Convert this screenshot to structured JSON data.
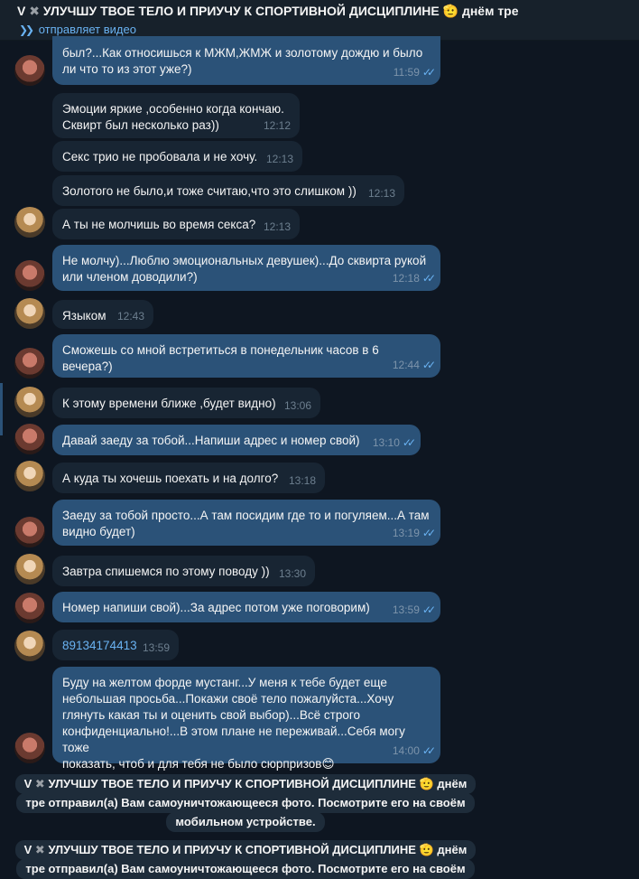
{
  "header": {
    "name_prefix": "V",
    "name_rest": "УЛУЧШУ ТВОЕ ТЕЛО И ПРИУЧУ К СПОРТИВНОЙ ДИСЦИПЛИНЕ",
    "name_suffix": "днём тре",
    "status": "отправляет видео",
    "icons": {
      "x": "✖",
      "salute": "🫡"
    }
  },
  "messages": [
    {
      "dir": "out",
      "text": "был?...Как относишься к МЖМ,ЖМЖ и золотому дождю и было\nли что то из этот уже?)",
      "time": "11:59",
      "read": "✓✓"
    },
    {
      "dir": "in",
      "text": "Эмоции яркие ,особенно когда кончаю.\nСквирт был несколько раз))",
      "time": "12:12"
    },
    {
      "dir": "in",
      "text": "Секс трио не пробовала и не хочу.",
      "time": "12:13"
    },
    {
      "dir": "in",
      "text": "Золотого не было,и тоже считаю,что это слишком ))",
      "time": "12:13"
    },
    {
      "dir": "in",
      "text": "А ты не молчишь во время секса?",
      "time": "12:13"
    },
    {
      "dir": "out",
      "text": "Не молчу)...Люблю эмоциональных девушек)...До сквирта рукой\nили членом доводили?)",
      "time": "12:18",
      "read": "✓✓"
    },
    {
      "dir": "in",
      "text": "Языком",
      "time": "12:43"
    },
    {
      "dir": "out",
      "text": "Сможешь со мной встретиться в понедельник часов в 6 вечера?)",
      "time": "12:44",
      "read": "✓✓"
    },
    {
      "dir": "in",
      "text": "К этому времени ближе ,будет видно)",
      "time": "13:06"
    },
    {
      "dir": "out",
      "text": "Давай заеду за тобой...Напиши адрес и номер свой)",
      "time": "13:10",
      "read": "✓✓"
    },
    {
      "dir": "in",
      "text": "А куда ты хочешь поехать и на долго?",
      "time": "13:18"
    },
    {
      "dir": "out",
      "text": "Заеду за тобой просто...А там посидим где то и погуляем...А там\nвидно будет)",
      "time": "13:19",
      "read": "✓✓"
    },
    {
      "dir": "in",
      "text": "Завтра спишемся по этому поводу ))",
      "time": "13:30"
    },
    {
      "dir": "out",
      "text": "Номер напиши свой)...За адрес потом уже поговорим)",
      "time": "13:59",
      "read": "✓✓"
    },
    {
      "dir": "in",
      "text": "89134174413",
      "time": "13:59"
    },
    {
      "dir": "out",
      "text": "Буду на желтом форде мустанг...У меня к тебе будет еще\nнебольшая просьба...Покажи своё тело пожалуйста...Хочу\nглянуть какая ты и оценить свой выбор)...Всё строго\nконфиденциально!...В этом плане не переживай...Себя могу тоже\nпоказать, чтоб и для тебя не было сюрпризов",
      "emoji": "😊",
      "time": "14:00",
      "read": "✓✓"
    }
  ],
  "system_notices": [
    {
      "line1_prefix": "V",
      "line1_name": "УЛУЧШУ ТВОЕ ТЕЛО И ПРИУЧУ К СПОРТИВНОЙ ДИСЦИПЛИНЕ",
      "line1_suffix": "днём",
      "line2": "тре отправил(а) Вам самоуничтожающееся фото. Посмотрите его на своём",
      "line3": "мобильном устройстве."
    },
    {
      "line1_prefix": "V",
      "line1_name": "УЛУЧШУ ТВОЕ ТЕЛО И ПРИУЧУ К СПОРТИВНОЙ ДИСЦИПЛИНЕ",
      "line1_suffix": "днём",
      "line2": "тре отправил(а) Вам самоуничтожающееся фото. Посмотрите его на своём",
      "line3": ""
    }
  ],
  "colors": {
    "background": "#0e1621",
    "outgoing_bubble": "#2b5278",
    "incoming_bubble": "#182533",
    "accent": "#6ab3f3"
  }
}
